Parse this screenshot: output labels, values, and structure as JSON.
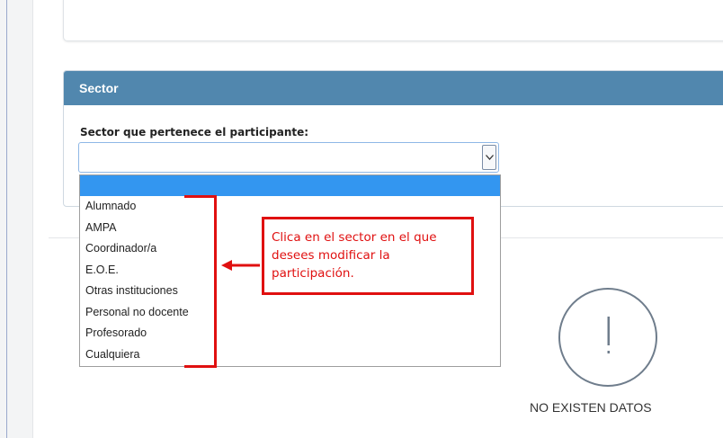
{
  "sector": {
    "title": "Sector",
    "field_label": "Sector que pertenece el participante:",
    "selected_value": "",
    "options": [
      "Alumnado",
      "AMPA",
      "Coordinador/a",
      "E.O.E.",
      "Otras instituciones",
      "Personal no docente",
      "Profesorado",
      "Cualquiera"
    ]
  },
  "annotation": {
    "callout_lines": [
      "Clica en el sector en el que",
      "desees modificar la",
      "participación."
    ]
  },
  "empty_state": {
    "text": "NO EXISTEN DATOS",
    "icon": "exclamation-icon"
  },
  "colors": {
    "header": "#5187ae",
    "highlight": "#3396f0",
    "annotation": "#e01010"
  }
}
